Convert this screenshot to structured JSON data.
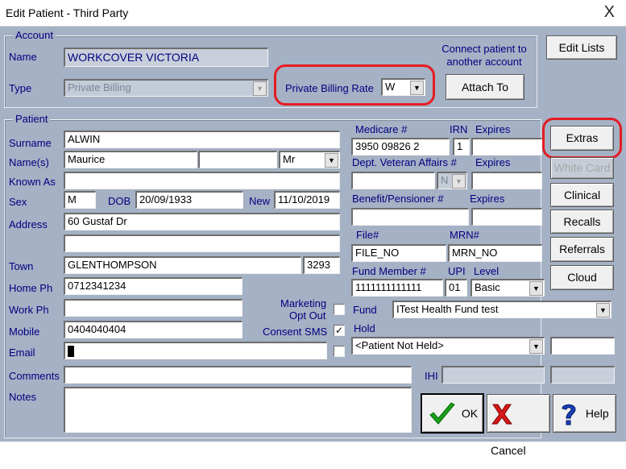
{
  "window": {
    "title": "Edit Patient - Third Party",
    "close_glyph": "X"
  },
  "account": {
    "group_title": "Account",
    "name_label": "Name",
    "name_value": "WORKCOVER VICTORIA",
    "type_label": "Type",
    "type_value": "Private Billing",
    "pbr_label": "Private Billing Rate",
    "pbr_value": "W",
    "connect_text_1": "Connect patient to",
    "connect_text_2": "another account",
    "attach_button": "Attach To"
  },
  "patient": {
    "group_title": "Patient",
    "surname_label": "Surname",
    "surname": "ALWIN",
    "names_label": "Name(s)",
    "first_name": "Maurice",
    "middle_name": "",
    "title": "Mr",
    "known_as_label": "Known As",
    "known_as": "",
    "sex_label": "Sex",
    "sex": "M",
    "dob_label": "DOB",
    "dob": "20/09/1933",
    "new_label": "New",
    "new_date": "11/10/2019",
    "address_label": "Address",
    "address_1": "60 Gustaf Dr",
    "address_2": "",
    "town_label": "Town",
    "town": "GLENTHOMPSON",
    "postcode": "3293",
    "home_ph_label": "Home Ph",
    "home_ph": "0712341234",
    "work_ph_label": "Work Ph",
    "work_ph": "",
    "mobile_label": "Mobile",
    "mobile": "0404040404",
    "email_label": "Email",
    "email": "",
    "marketing_label_1": "Marketing",
    "marketing_label_2": "Opt Out",
    "consent_sms_label": "Consent SMS",
    "consent_sms_check": "✓",
    "comments_label": "Comments",
    "comments": "",
    "notes_label": "Notes",
    "notes": ""
  },
  "medical": {
    "medicare_label": "Medicare #",
    "medicare": "3950 09826 2",
    "irn_label": "IRN",
    "irn": "1",
    "expires_label": "Expires",
    "medicare_expires": "",
    "dva_label": "Dept. Veteran Affairs #",
    "dva": "",
    "dva_type": "N",
    "dva_expires": "",
    "benefit_label": "Benefit/Pensioner #",
    "benefit": "",
    "benefit_expires": "",
    "file_label": "File#",
    "file": "FILE_NO",
    "mrn_label": "MRN#",
    "mrn": "MRN_NO",
    "fund_member_label": "Fund Member #",
    "fund_member": "1111111111111",
    "upi_label": "UPI",
    "upi": "01",
    "level_label": "Level",
    "level": "Basic",
    "fund_label": "Fund",
    "fund": "ITest Health Fund test",
    "hold_label": "Hold",
    "hold": "<Patient Not Held>",
    "ihi_label": "IHI",
    "ihi": ""
  },
  "buttons": {
    "edit_lists": "Edit Lists",
    "extras": "Extras",
    "white_card": "White Card",
    "clinical": "Clinical",
    "recalls": "Recalls",
    "referrals": "Referrals",
    "cloud": "Cloud",
    "ok": "OK",
    "cancel": "Cancel",
    "help": "Help"
  },
  "colors": {
    "dialog_bg": "#a5b1c4",
    "label_text": "#000080",
    "highlight_red": "#e51c23"
  }
}
